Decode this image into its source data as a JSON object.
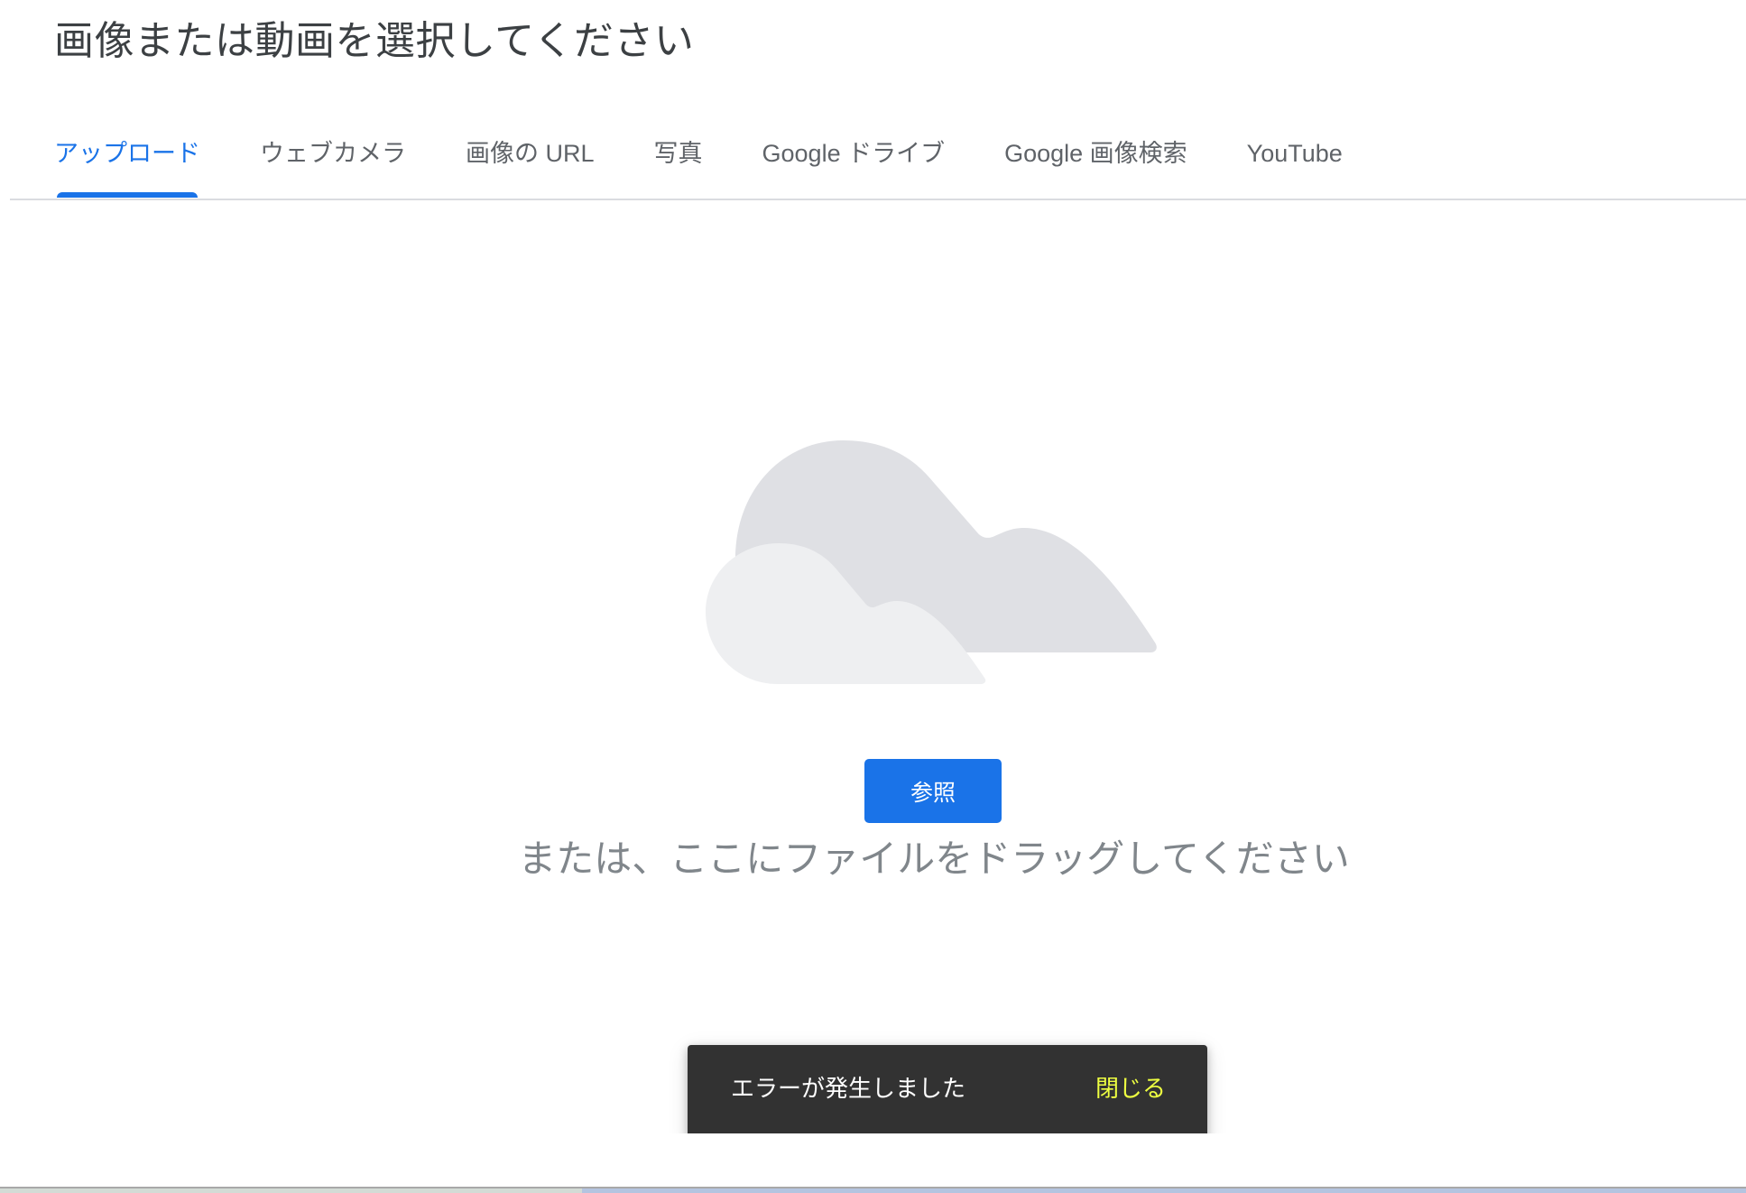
{
  "dialog": {
    "title": "画像または動画を選択してください"
  },
  "tabs": [
    {
      "label": "アップロード",
      "active": true
    },
    {
      "label": "ウェブカメラ",
      "active": false
    },
    {
      "label": "画像の URL",
      "active": false
    },
    {
      "label": "写真",
      "active": false
    },
    {
      "label": "Google ドライブ",
      "active": false
    },
    {
      "label": "Google 画像検索",
      "active": false
    },
    {
      "label": "YouTube",
      "active": false
    }
  ],
  "upload": {
    "illustration_icon": "cloud-icon",
    "browse_label": "参照",
    "drag_text": "または、ここにファイルをドラッグしてください"
  },
  "snackbar": {
    "message": "エラーが発生しました",
    "action_label": "閉じる"
  },
  "colors": {
    "accent": "#1a73e8",
    "title_text": "#3c4043",
    "tab_text": "#5f6368",
    "secondary_text": "#80868b",
    "snackbar_bg": "#323232",
    "snackbar_action": "#eeff41",
    "cloud_back": "#dfe0e4",
    "cloud_front": "#eeeff1"
  }
}
